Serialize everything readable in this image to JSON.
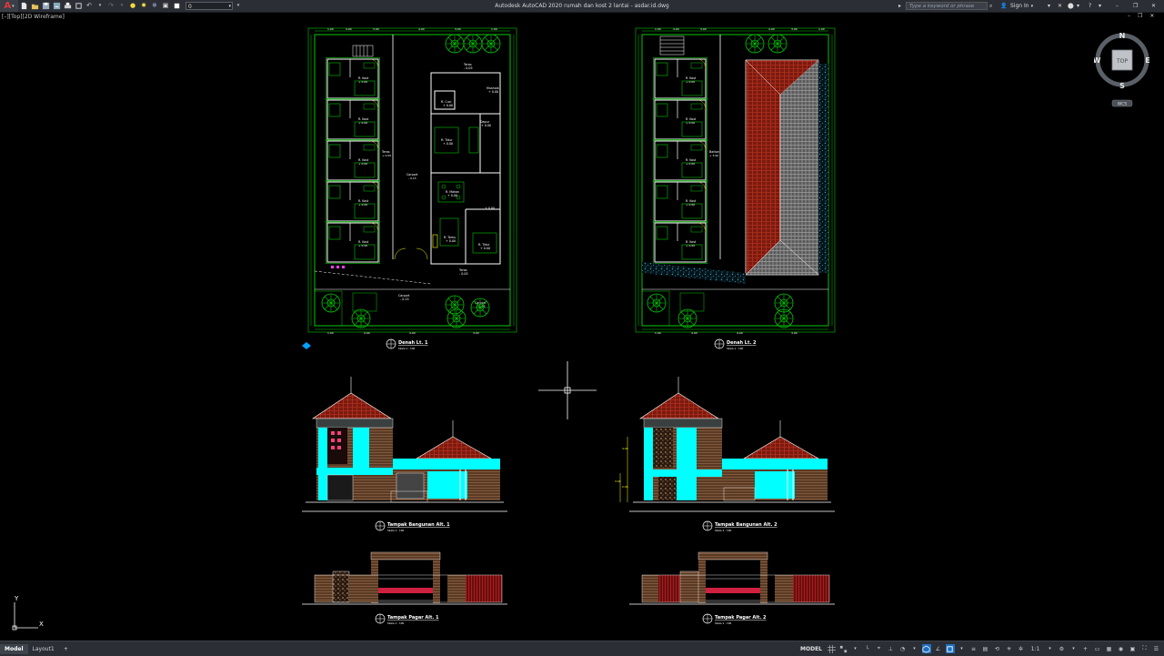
{
  "app": {
    "logo_letter": "A",
    "window_title": "Autodesk AutoCAD 2020   rumah dan kost 2 lantai - asdar.id.dwg",
    "workspace_value": "0",
    "search_placeholder": "Type a keyword or phrase",
    "sign_in_label": "Sign In",
    "icons": [
      "new-icon",
      "open-icon",
      "save-icon",
      "save-as-icon",
      "print-icon",
      "plot-icon",
      "undo-icon",
      "redo-icon",
      "layer-icon"
    ]
  },
  "viewport": {
    "label": "[–][Top][2D Wireframe]"
  },
  "drawing": {
    "plan1": {
      "title": "Denah Lt. 1",
      "scale": "Skala 1 : 100",
      "rooms": [
        "R. Kost",
        "R. Kost",
        "R. Kost",
        "R. Kost",
        "R. Kost",
        "Teras",
        "Carport",
        "R. Tamu",
        "R. Makan",
        "R. Tidur",
        "Dapur",
        "R. Cuci",
        "Teras",
        "Carport",
        "Taman"
      ]
    },
    "plan2": {
      "title": "Denah Lt. 2",
      "scale": "Skala 1 : 100",
      "rooms": [
        "R. Kost",
        "R. Kost",
        "R. Kost",
        "R. Kost",
        "R. Kost",
        "Balkon"
      ]
    },
    "elev1": {
      "title": "Tampak Bangunan Alt. 1",
      "scale": "Skala 1 : 100"
    },
    "elev2": {
      "title": "Tampak Bangunan Alt. 2",
      "scale": "Skala 1 : 100"
    },
    "fence1": {
      "title": "Tampak Pagar Alt. 1",
      "scale": "Skala 1 : 100"
    },
    "fence2": {
      "title": "Tampak Pagar Alt. 2",
      "scale": "Skala 1 : 100"
    },
    "colors": {
      "green": "#00c800",
      "grey": "#9a9a9a",
      "brick": "#b03020",
      "cyan": "#00ffff",
      "wood": "#8a5a3a",
      "white": "#ffffff"
    }
  },
  "viewcube": {
    "north": "N",
    "south": "S",
    "east": "E",
    "west": "W",
    "top": "TOP",
    "wcs": "WCS"
  },
  "ucs": {
    "x": "X",
    "y": "Y"
  },
  "status": {
    "tabs": [
      "Model",
      "Layout1"
    ],
    "add_tab": "+",
    "model_label": "MODEL",
    "scale_label": "1:1"
  }
}
